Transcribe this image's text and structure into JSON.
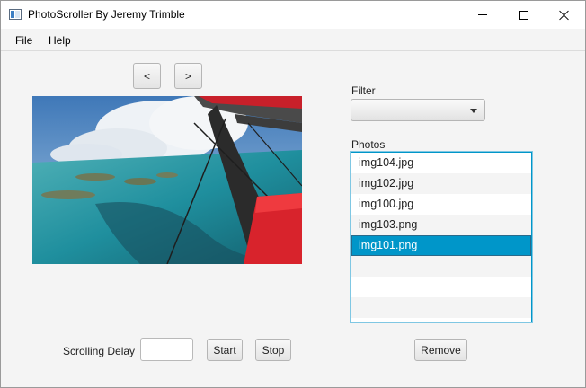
{
  "window": {
    "title": "PhotoScroller By Jeremy Trimble"
  },
  "menu": {
    "file": "File",
    "help": "Help"
  },
  "nav": {
    "prev": "<",
    "next": ">"
  },
  "filter": {
    "label": "Filter",
    "value": ""
  },
  "photos": {
    "label": "Photos",
    "items": [
      "img104.jpg",
      "img102.jpg",
      "img100.jpg",
      "img103.png",
      "img101.png"
    ],
    "selected": "img101.png"
  },
  "controls": {
    "delay_label": "Scrolling Delay",
    "delay_value": "",
    "start": "Start",
    "stop": "Stop",
    "remove": "Remove"
  },
  "colors": {
    "selection": "#0096c9",
    "list_border": "#0096c9"
  }
}
